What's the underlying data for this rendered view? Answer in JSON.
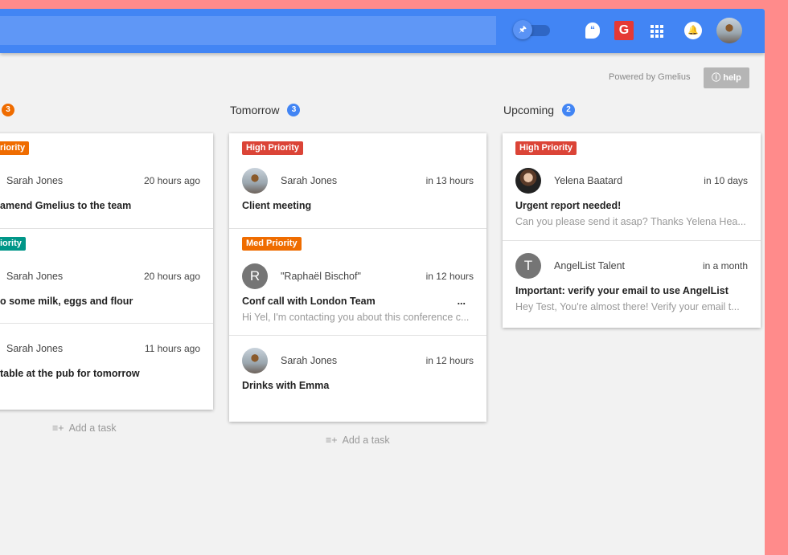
{
  "header": {
    "toggle_icon": "pin-icon",
    "hangouts_icon": "hangouts-icon",
    "gmelius_icon": "gmelius-icon",
    "apps_icon": "apps-grid-icon",
    "bell_icon": "bell-icon"
  },
  "powered_by": "Powered by Gmelius",
  "help_label": "help",
  "colors": {
    "header": "#4285f4",
    "high": "#db4437",
    "med": "#ef6c00",
    "low": "#009688",
    "count_blue": "#4285f4",
    "count_orange": "#ef6c00"
  },
  "add_task": "Add a task",
  "columns": [
    {
      "title": "",
      "count": "3",
      "items": [
        {
          "badge": "riority",
          "name": "Sarah Jones",
          "time": "20 hours ago",
          "title": "amend Gmelius to the team"
        },
        {
          "badge": "iority",
          "name": "Sarah Jones",
          "time": "20 hours ago",
          "title": "o some milk, eggs and flour"
        },
        {
          "name": "Sarah Jones",
          "time": "11 hours ago",
          "title": "table at the pub for tomorrow"
        }
      ]
    },
    {
      "title": "Tomorrow",
      "count": "3",
      "items": [
        {
          "badge": "High Priority",
          "name": "Sarah Jones",
          "time": "in 13 hours",
          "title": "Client meeting"
        },
        {
          "badge": "Med Priority",
          "avatar_letter": "R",
          "name": "\"Raphaël Bischof\"",
          "time": "in 12 hours",
          "title": "Conf call with London Team",
          "more": "...",
          "snippet": "Hi Yel, I'm contacting you about this conference c..."
        },
        {
          "name": "Sarah Jones",
          "time": "in 12 hours",
          "title": "Drinks with Emma"
        }
      ]
    },
    {
      "title": "Upcoming",
      "count": "2",
      "items": [
        {
          "badge": "High Priority",
          "name": "Yelena Baatard",
          "time": "in 10 days",
          "title": "Urgent report needed!",
          "snippet": "Can you please send it asap? Thanks Yelena Hea..."
        },
        {
          "avatar_letter": "T",
          "name": "AngelList Talent",
          "time": "in a month",
          "title": "Important: verify your email to use AngelList",
          "snippet": "Hey Test, You're almost there! Verify your email t..."
        }
      ]
    }
  ]
}
